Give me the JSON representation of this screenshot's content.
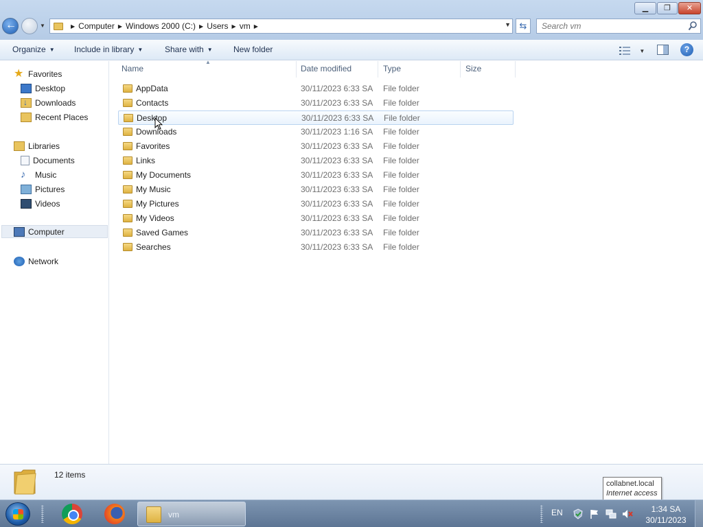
{
  "window": {
    "minimize_symbol": "▁",
    "maximize_symbol": "❐",
    "close_symbol": "✕"
  },
  "address_bar": {
    "breadcrumbs": [
      "Computer",
      "Windows 2000 (C:)",
      "Users",
      "vm"
    ],
    "search_placeholder": "Search vm"
  },
  "command_bar": {
    "organize": "Organize",
    "include_in_library": "Include in library",
    "share_with": "Share with",
    "new_folder": "New folder",
    "help_symbol": "?"
  },
  "nav_pane": {
    "favorites": {
      "label": "Favorites",
      "items": [
        "Desktop",
        "Downloads",
        "Recent Places"
      ]
    },
    "libraries": {
      "label": "Libraries",
      "items": [
        "Documents",
        "Music",
        "Pictures",
        "Videos"
      ]
    },
    "computer": "Computer",
    "network": "Network"
  },
  "columns": [
    "Name",
    "Date modified",
    "Type",
    "Size"
  ],
  "files": [
    {
      "name": "AppData",
      "date": "30/11/2023 6:33 SA",
      "type": "File folder"
    },
    {
      "name": "Contacts",
      "date": "30/11/2023 6:33 SA",
      "type": "File folder"
    },
    {
      "name": "Desktop",
      "date": "30/11/2023 6:33 SA",
      "type": "File folder"
    },
    {
      "name": "Downloads",
      "date": "30/11/2023 1:16 SA",
      "type": "File folder"
    },
    {
      "name": "Favorites",
      "date": "30/11/2023 6:33 SA",
      "type": "File folder"
    },
    {
      "name": "Links",
      "date": "30/11/2023 6:33 SA",
      "type": "File folder"
    },
    {
      "name": "My Documents",
      "date": "30/11/2023 6:33 SA",
      "type": "File folder"
    },
    {
      "name": "My Music",
      "date": "30/11/2023 6:33 SA",
      "type": "File folder"
    },
    {
      "name": "My Pictures",
      "date": "30/11/2023 6:33 SA",
      "type": "File folder"
    },
    {
      "name": "My Videos",
      "date": "30/11/2023 6:33 SA",
      "type": "File folder"
    },
    {
      "name": "Saved Games",
      "date": "30/11/2023 6:33 SA",
      "type": "File folder"
    },
    {
      "name": "Searches",
      "date": "30/11/2023 6:33 SA",
      "type": "File folder"
    }
  ],
  "hovered_row": 2,
  "details_pane": {
    "item_count": "12 items"
  },
  "tooltip": {
    "host": "collabnet.local",
    "status": "Internet access"
  },
  "taskbar": {
    "explorer_label": "vm",
    "language": "EN",
    "time": "1:34 SA",
    "date": "30/11/2023"
  },
  "colors": {
    "accent": "#3a6bb0",
    "hover_border": "#b9d3f0",
    "folder": "#e9c45e"
  }
}
